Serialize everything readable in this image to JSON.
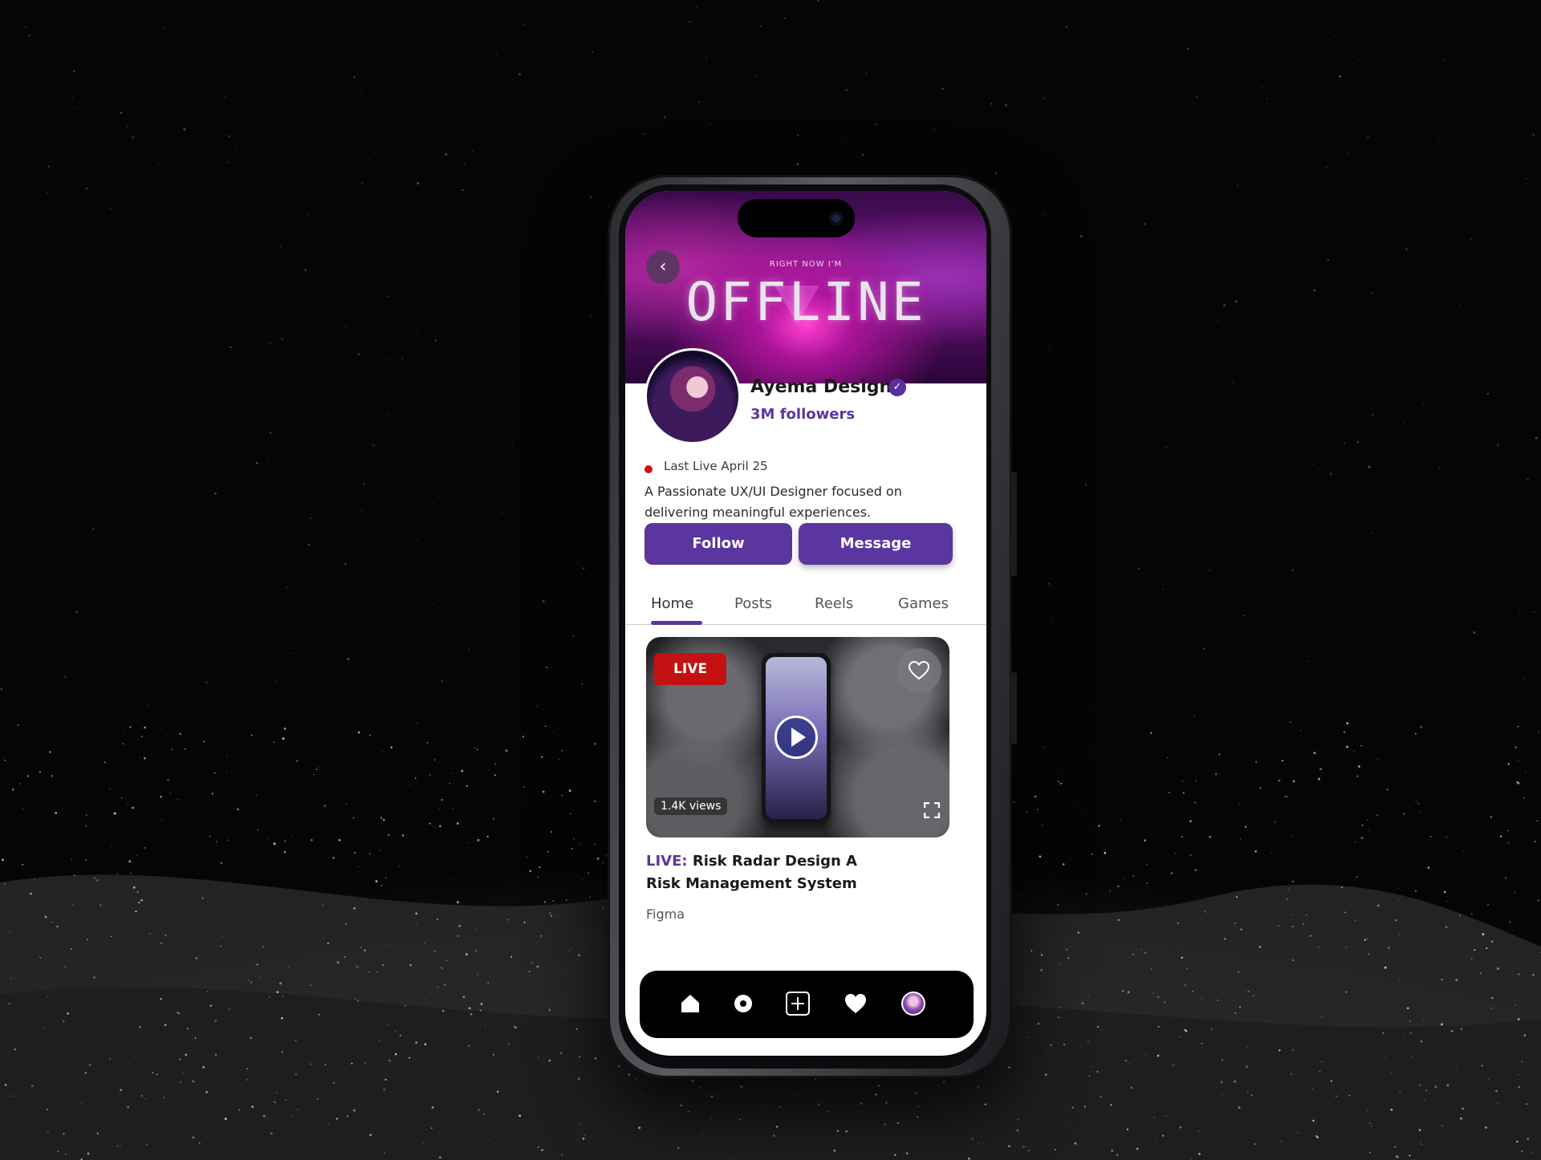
{
  "banner": {
    "pre_text": "RIGHT NOW I'M",
    "status_text": "OFFLINE"
  },
  "profile": {
    "name": "Ayema Designs",
    "followers": "3M followers",
    "last_live": "Last Live April 25",
    "bio": "A Passionate UX/UI Designer focused on delivering meaningful experiences."
  },
  "actions": {
    "follow_label": "Follow",
    "message_label": "Message"
  },
  "tabs": [
    {
      "label": "Home",
      "active": true
    },
    {
      "label": "Posts",
      "active": false
    },
    {
      "label": "Reels",
      "active": false
    },
    {
      "label": "Games",
      "active": false
    }
  ],
  "video": {
    "badge": "LIVE",
    "views": "1.4K views",
    "title_prefix": "LIVE:",
    "title": "Risk Radar Design A Risk Management System",
    "app": "Figma"
  },
  "nav": {
    "items": [
      "home-icon",
      "explore-icon",
      "add-icon",
      "heart-icon",
      "profile-avatar"
    ]
  },
  "colors": {
    "accent": "#5b35a0",
    "live_red": "#c41212",
    "background": "#050505"
  }
}
